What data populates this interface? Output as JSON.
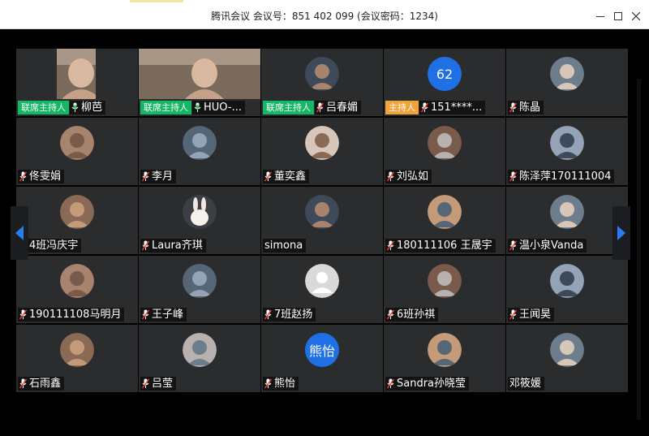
{
  "window": {
    "title": "腾讯会议 会议号：851 402 099  (会议密码：1234)",
    "controls": [
      "minimize-icon",
      "maximize-icon",
      "close-icon"
    ]
  },
  "colors": {
    "tile_bg": "#2b2c2e",
    "cohost_badge": "#15b764",
    "host_badge": "#f2a23a",
    "mic_muted": "#ff3b30",
    "mic_active": "#34c759",
    "nav_arrow": "#2b7cf0"
  },
  "participants": [
    {
      "name": "柳芭",
      "badge": "联席主持人",
      "mic": "active",
      "avatar": "video-feed"
    },
    {
      "name": "HUO-...",
      "badge": "联席主持人",
      "mic": "active",
      "avatar": "video-feed"
    },
    {
      "name": "吕春媚",
      "badge": "联席主持人",
      "mic": "muted",
      "avatar": "cartoon-avatar"
    },
    {
      "name": "151****...",
      "badge": "主持人",
      "mic": "muted",
      "avatar": "text",
      "avatar_text": "62",
      "avatar_color": "#1f6fe5"
    },
    {
      "name": "陈晶",
      "mic": "muted",
      "avatar": "photo-avatar"
    },
    {
      "name": "佟雯娟",
      "mic": "muted",
      "avatar": "cat-avatar"
    },
    {
      "name": "李月",
      "mic": "muted",
      "avatar": "photo-avatar"
    },
    {
      "name": "董奕鑫",
      "mic": "muted",
      "avatar": "cat-avatar"
    },
    {
      "name": "刘弘如",
      "mic": "muted",
      "avatar": "photo-avatar"
    },
    {
      "name": "陈泽萍170111004",
      "mic": "muted",
      "avatar": "photo-avatar"
    },
    {
      "name": "4班冯庆宇",
      "mic": "muted",
      "avatar": "photo-avatar"
    },
    {
      "name": "Laura齐琪",
      "mic": "muted",
      "avatar": "rabbit-avatar"
    },
    {
      "name": "simona",
      "mic": "none",
      "avatar": "cartoon-avatar"
    },
    {
      "name": "180111106 王晟宇",
      "mic": "muted",
      "avatar": "landscape-avatar"
    },
    {
      "name": "温小泉Vanda",
      "mic": "muted",
      "avatar": "photo-avatar"
    },
    {
      "name": "190111108马明月",
      "mic": "muted",
      "avatar": "photo-avatar"
    },
    {
      "name": "王子峰",
      "mic": "muted",
      "avatar": "photo-avatar"
    },
    {
      "name": "7班赵扬",
      "mic": "muted",
      "avatar": "default-user-avatar"
    },
    {
      "name": "6班孙祺",
      "mic": "muted",
      "avatar": "pet-avatar"
    },
    {
      "name": "王闻昊",
      "mic": "muted",
      "avatar": "anime-avatar"
    },
    {
      "name": "石雨鑫",
      "mic": "muted",
      "avatar": "anime-avatar"
    },
    {
      "name": "吕莹",
      "mic": "muted",
      "avatar": "photo-avatar"
    },
    {
      "name": "熊怡",
      "mic": "muted",
      "avatar": "text",
      "avatar_text": "熊怡",
      "avatar_color": "#1f6fe5"
    },
    {
      "name": "Sandra孙晓莹",
      "mic": "muted",
      "avatar": "cartoon-avatar"
    },
    {
      "name": "邓筱媛",
      "mic": "none",
      "avatar": "anime-avatar"
    }
  ],
  "navigation": {
    "prev": "left-arrow-icon",
    "next": "right-arrow-icon"
  }
}
